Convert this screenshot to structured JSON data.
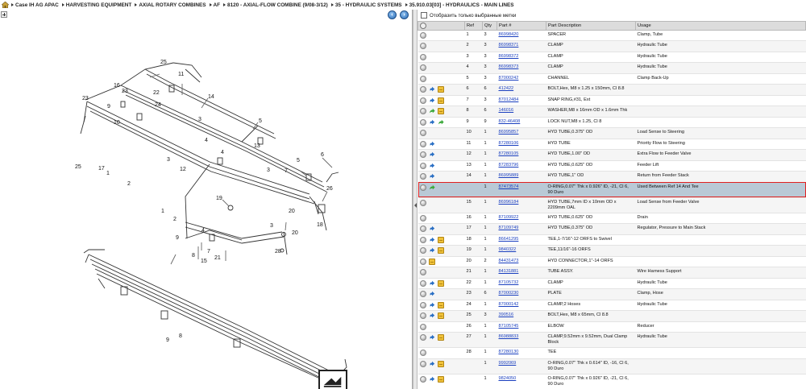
{
  "breadcrumb": [
    "Case IH AG APAC",
    "HARVESTING EQUIPMENT",
    "AXIAL ROTARY COMBINES",
    "AF",
    "8120 - AXIAL-FLOW COMBINE (9/08-3/12)",
    "35 - HYDRAULIC SYSTEMS",
    "35.910.03[03] - HYDRAULICS - MAIN LINES"
  ],
  "filter": {
    "label": "Отобразить только выбранные метки",
    "checked": false
  },
  "table": {
    "headers": [
      "Ref",
      "Qty",
      "Part #",
      "Part Description",
      "Usage"
    ],
    "rows": [
      {
        "icons": [
          "info"
        ],
        "ref": "1",
        "qty": "3",
        "part": "86998420",
        "desc": "SPACER",
        "usage": "Clamp, Tube"
      },
      {
        "icons": [
          "info"
        ],
        "ref": "2",
        "qty": "3",
        "part": "86998371",
        "desc": "CLAMP",
        "usage": "Hydraulic Tube"
      },
      {
        "icons": [
          "info"
        ],
        "ref": "3",
        "qty": "3",
        "part": "86998372",
        "desc": "CLAMP",
        "usage": "Hydraulic Tube"
      },
      {
        "icons": [
          "info"
        ],
        "ref": "4",
        "qty": "3",
        "part": "86998373",
        "desc": "CLAMP",
        "usage": "Hydraulic Tube"
      },
      {
        "icons": [
          "info"
        ],
        "ref": "5",
        "qty": "3",
        "part": "87000242",
        "desc": "CHANNEL",
        "usage": "Clamp Back-Up"
      },
      {
        "icons": [
          "info",
          "link",
          "box"
        ],
        "ref": "6",
        "qty": "6",
        "part": "412422",
        "desc": "BOLT,Hex, M8 x 1.25 x 150mm, Cl 8.8",
        "usage": ""
      },
      {
        "icons": [
          "info",
          "link",
          "box"
        ],
        "ref": "7",
        "qty": "3",
        "part": "87012484",
        "desc": "SNAP RING,#31, Ext",
        "usage": ""
      },
      {
        "icons": [
          "info",
          "green",
          "box"
        ],
        "ref": "8",
        "qty": "6",
        "part": "146016",
        "desc": "WASHER,M8 x 16mm OD x 1.6mm Thk",
        "usage": ""
      },
      {
        "icons": [
          "info",
          "link",
          "green"
        ],
        "ref": "9",
        "qty": "9",
        "part": "832-46408",
        "desc": "LOCK NUT,M8 x 1.25, Cl 8",
        "usage": ""
      },
      {
        "icons": [
          "info"
        ],
        "ref": "10",
        "qty": "1",
        "part": "86995857",
        "desc": "HYD TUBE,0.375\" OD",
        "usage": "Load Sense to Steering"
      },
      {
        "icons": [
          "info",
          "link"
        ],
        "ref": "11",
        "qty": "1",
        "part": "87280106",
        "desc": "HYD TUBE",
        "usage": "Priority Flow to Steering"
      },
      {
        "icons": [
          "info",
          "link"
        ],
        "ref": "12",
        "qty": "1",
        "part": "87280105",
        "desc": "HYD TUBE,1.00\" OD",
        "usage": "Extra Flow to Feeder Valve"
      },
      {
        "icons": [
          "info",
          "link"
        ],
        "ref": "13",
        "qty": "1",
        "part": "87283796",
        "desc": "HYD TUBE,0.625\" OD",
        "usage": "Feeder Lift"
      },
      {
        "icons": [
          "info",
          "link"
        ],
        "ref": "14",
        "qty": "1",
        "part": "86995889",
        "desc": "HYD TUBE,1\" OD",
        "usage": "Return from Feeder Stack"
      },
      {
        "icons": [
          "info",
          "green"
        ],
        "ref": "",
        "qty": "1",
        "part": "87473574",
        "desc": "O-RING,0.07\" Thk x 0.926\" ID, -21, Cl 6, 90 Duro",
        "usage": "Used Between Ref 14 And Tee",
        "selected": true
      },
      {
        "icons": [
          "info"
        ],
        "ref": "15",
        "qty": "1",
        "part": "86996184",
        "desc": "HYD TUBE,7mm ID x 10mm OD x 2209mm OAL",
        "usage": "Load Sense from Feeder Valve"
      },
      {
        "icons": [
          "info"
        ],
        "ref": "16",
        "qty": "1",
        "part": "87109922",
        "desc": "HYD TUBE,0.625\" OD",
        "usage": "Drain"
      },
      {
        "icons": [
          "info",
          "link"
        ],
        "ref": "17",
        "qty": "1",
        "part": "87109749",
        "desc": "HYD TUBE,0.375\" OD",
        "usage": "Regulator, Pressure to Main Stack"
      },
      {
        "icons": [
          "info",
          "link",
          "box"
        ],
        "ref": "18",
        "qty": "1",
        "part": "86641295",
        "desc": "TEE,1-7/16\"-12 ORFS to Swivel",
        "usage": ""
      },
      {
        "icons": [
          "info",
          "link",
          "box"
        ],
        "ref": "19",
        "qty": "1",
        "part": "9840322",
        "desc": "TEE,11/16\"-16 ORFS",
        "usage": ""
      },
      {
        "icons": [
          "info",
          "box"
        ],
        "ref": "20",
        "qty": "2",
        "part": "84431473",
        "desc": "HYD CONNECTOR,1\"-14 ORFS",
        "usage": ""
      },
      {
        "icons": [
          "info"
        ],
        "ref": "21",
        "qty": "1",
        "part": "84131881",
        "desc": "TUBE ASSY.",
        "usage": "Wire Harness Support"
      },
      {
        "icons": [
          "info",
          "link",
          "box"
        ],
        "ref": "22",
        "qty": "1",
        "part": "87105732",
        "desc": "CLAMP",
        "usage": "Hydraulic Tube"
      },
      {
        "icons": [
          "info",
          "link"
        ],
        "ref": "23",
        "qty": "6",
        "part": "87000230",
        "desc": "PLATE",
        "usage": "Clamp, Hose"
      },
      {
        "icons": [
          "info",
          "link",
          "box"
        ],
        "ref": "24",
        "qty": "1",
        "part": "87000142",
        "desc": "CLAMP,2 Hoses",
        "usage": "Hydraulic Tube"
      },
      {
        "icons": [
          "info",
          "link",
          "box"
        ],
        "ref": "25",
        "qty": "3",
        "part": "390516",
        "desc": "BOLT,Hex, M8 x 65mm, Cl 8.8",
        "usage": ""
      },
      {
        "icons": [
          "info"
        ],
        "ref": "26",
        "qty": "1",
        "part": "87105745",
        "desc": "ELBOW",
        "usage": "Reducer"
      },
      {
        "icons": [
          "info",
          "link",
          "box"
        ],
        "ref": "27",
        "qty": "1",
        "part": "86988833",
        "desc": "CLAMP,9.52mm x 9.52mm, Dual Clamp Block",
        "usage": "Hydraulic Tube"
      },
      {
        "icons": [
          "info"
        ],
        "ref": "28",
        "qty": "1",
        "part": "87280130",
        "desc": "TEE",
        "usage": ""
      },
      {
        "icons": [
          "info",
          "link",
          "box"
        ],
        "ref": "",
        "qty": "1",
        "part": "9992069",
        "desc": "O-RING,0.07\" Thk x 0.614\" ID, -16, Cl 6, 90 Duro",
        "usage": ""
      },
      {
        "icons": [
          "info",
          "link",
          "box"
        ],
        "ref": "",
        "qty": "1",
        "part": "9824050",
        "desc": "O-RING,0.07\" Thk x 0.926\" ID, -21, Cl 6, 90 Duro",
        "usage": ""
      }
    ]
  },
  "diagram_callouts": [
    "25",
    "11",
    "16",
    "22",
    "23",
    "14",
    "23",
    "9",
    "24",
    "10",
    "3",
    "5",
    "4",
    "13",
    "12",
    "26",
    "6",
    "5",
    "7",
    "3",
    "4",
    "3",
    "25",
    "17",
    "1",
    "2",
    "1",
    "19",
    "20",
    "2",
    "9",
    "4",
    "18",
    "20",
    "3",
    "28",
    "7",
    "8",
    "15",
    "21",
    "9",
    "8"
  ],
  "colors": {
    "selected_row": "#b9c9d6",
    "selected_outline": "#e02020",
    "link": "#1a3fbf"
  },
  "icons": {
    "home": "home-icon",
    "prev": "arrow-left-icon",
    "next": "arrow-right-icon",
    "info": "info-icon",
    "link": "link-icon",
    "box": "package-icon",
    "green": "green-arrow-icon"
  }
}
